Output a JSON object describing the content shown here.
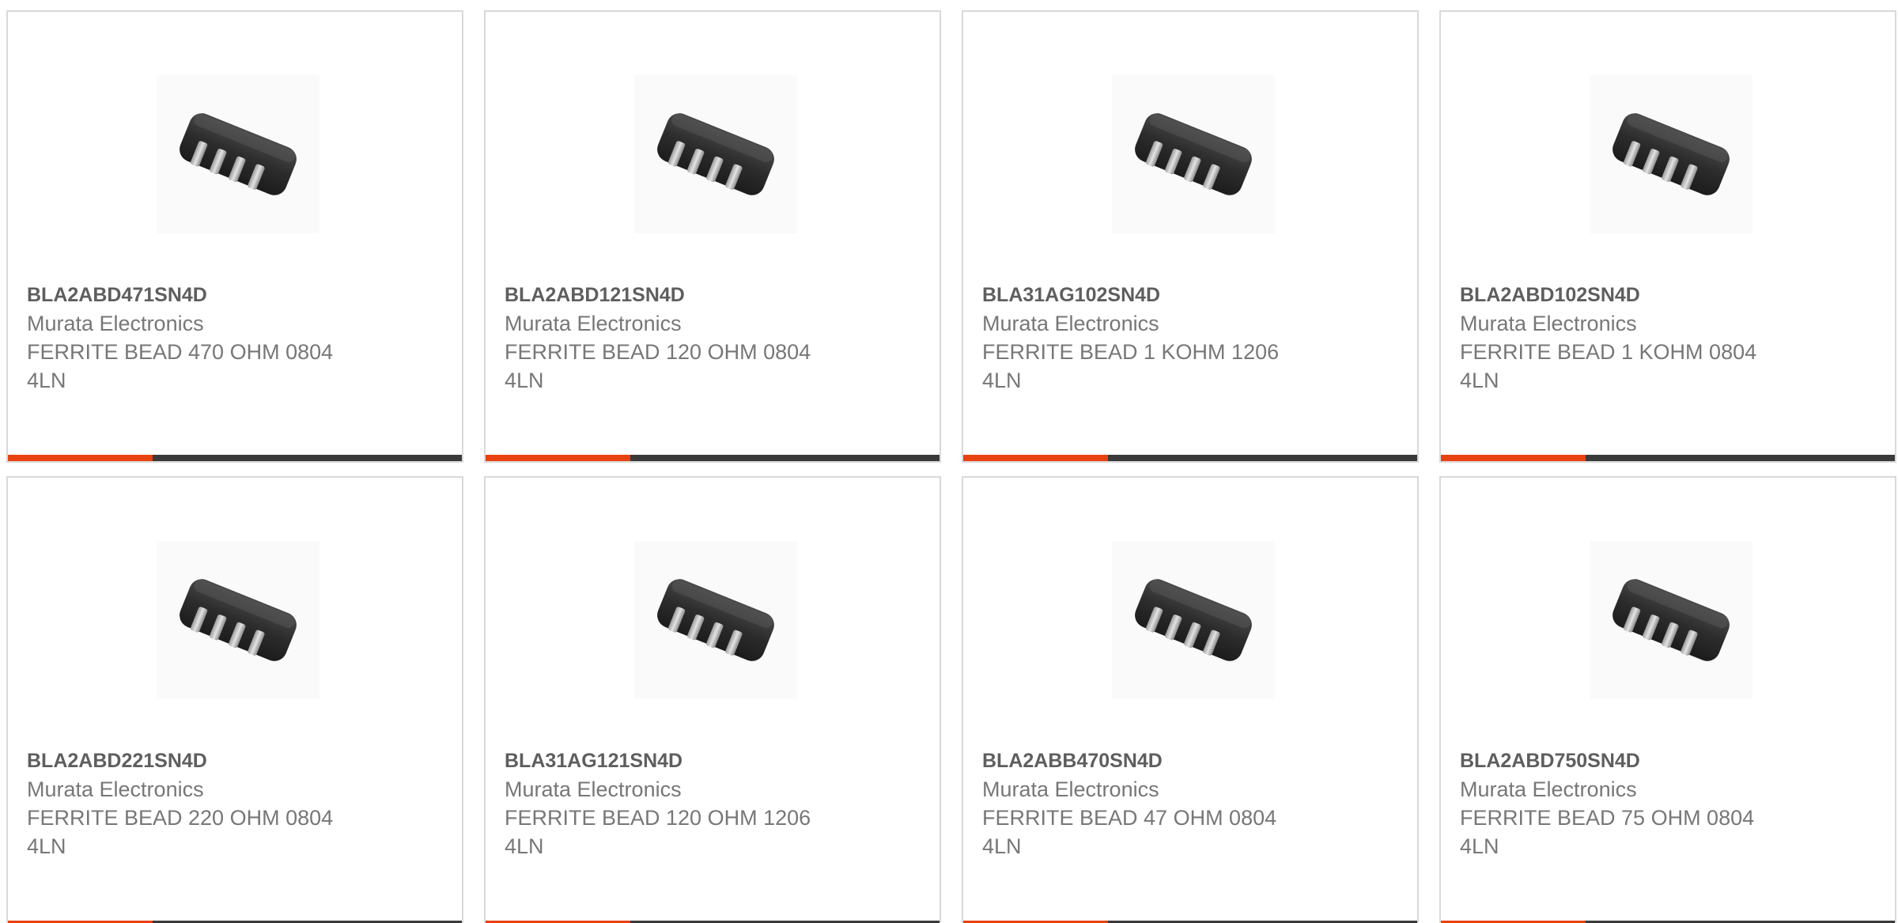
{
  "products": [
    {
      "part": "BLA2ABD471SN4D",
      "manufacturer": "Murata Electronics",
      "description": "FERRITE BEAD 470 OHM 0804 4LN",
      "image": "chip-ferrite-bead-array-icon"
    },
    {
      "part": "BLA2ABD121SN4D",
      "manufacturer": "Murata Electronics",
      "description": "FERRITE BEAD 120 OHM 0804 4LN",
      "image": "chip-ferrite-bead-array-icon"
    },
    {
      "part": "BLA31AG102SN4D",
      "manufacturer": "Murata Electronics",
      "description": "FERRITE BEAD 1 KOHM 1206 4LN",
      "image": "chip-ferrite-bead-array-icon"
    },
    {
      "part": "BLA2ABD102SN4D",
      "manufacturer": "Murata Electronics",
      "description": "FERRITE BEAD 1 KOHM 0804 4LN",
      "image": "chip-ferrite-bead-array-icon"
    },
    {
      "part": "BLA2ABD221SN4D",
      "manufacturer": "Murata Electronics",
      "description": "FERRITE BEAD 220 OHM 0804 4LN",
      "image": "chip-ferrite-bead-array-icon"
    },
    {
      "part": "BLA31AG121SN4D",
      "manufacturer": "Murata Electronics",
      "description": "FERRITE BEAD 120 OHM 1206 4LN",
      "image": "chip-ferrite-bead-array-icon"
    },
    {
      "part": "BLA2ABB470SN4D",
      "manufacturer": "Murata Electronics",
      "description": "FERRITE BEAD 47 OHM 0804 4LN",
      "image": "chip-ferrite-bead-array-icon"
    },
    {
      "part": "BLA2ABD750SN4D",
      "manufacturer": "Murata Electronics",
      "description": "FERRITE BEAD 75 OHM 0804 4LN",
      "image": "chip-ferrite-bead-array-icon"
    }
  ],
  "colors": {
    "accent": "#e84211",
    "bar": "#3a3a3a",
    "border": "#d9d9d9",
    "part_text": "#5e5e5e",
    "body_text": "#777777"
  }
}
